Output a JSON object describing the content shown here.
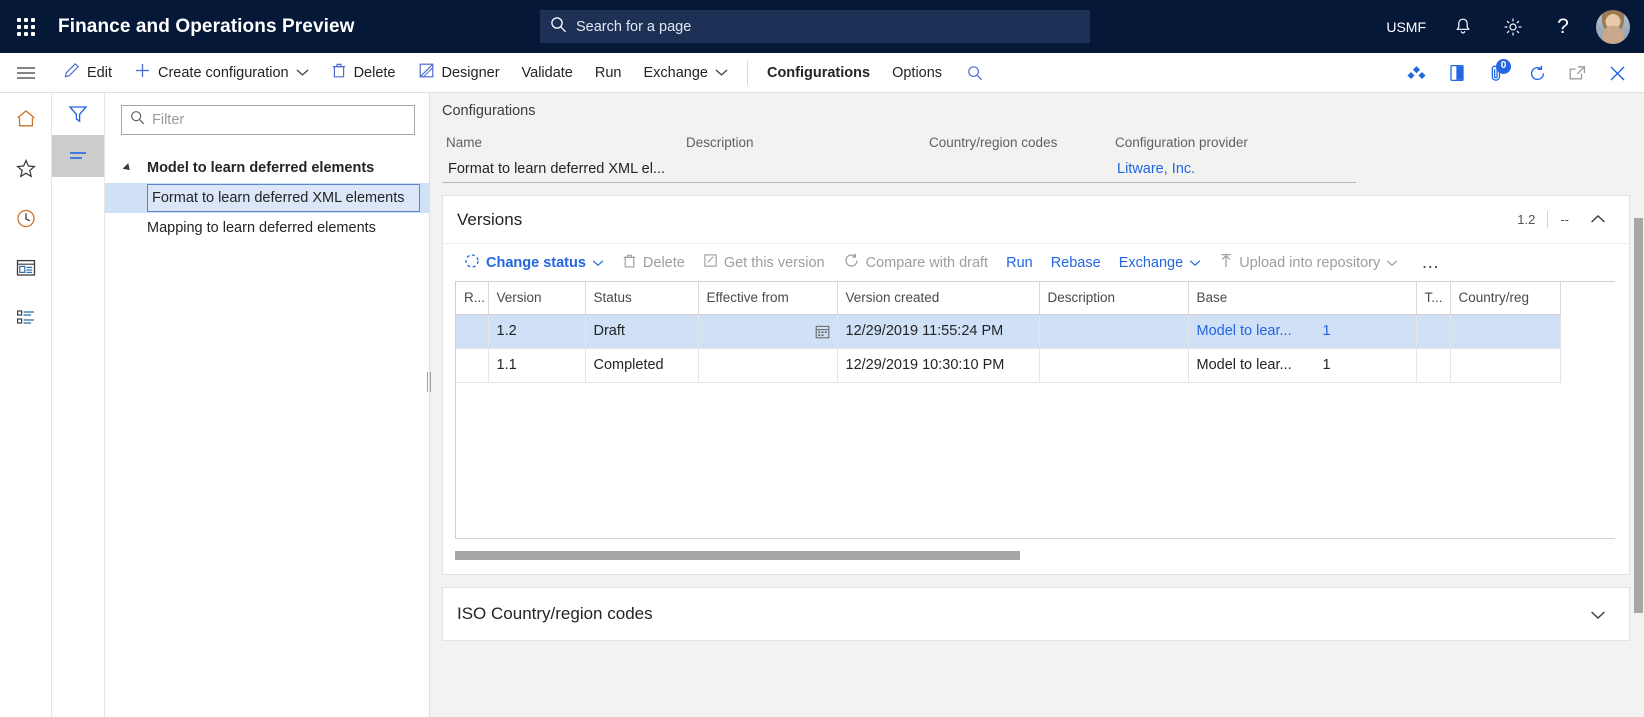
{
  "topbar": {
    "app_title": "Finance and Operations Preview",
    "waffle_icon": "app-launcher-icon",
    "search": {
      "placeholder": "Search for a page",
      "value": "",
      "icon": "search-icon"
    },
    "company": "USMF",
    "notifications_icon": "bell-icon",
    "settings_icon": "gear-icon",
    "help_icon": "question-mark-icon",
    "avatar": "user-avatar",
    "bg_color": "#061838",
    "search_bg_color": "#1d3055"
  },
  "actionpane": {
    "menu_icon": "hamburger-menu-icon",
    "buttons": [
      {
        "label": "Edit",
        "icon": "pencil-icon",
        "has_chevron": false,
        "bold": false
      },
      {
        "label": "Create configuration",
        "icon": "plus-icon",
        "has_chevron": true,
        "bold": false
      },
      {
        "label": "Delete",
        "icon": "trash-icon",
        "has_chevron": false,
        "bold": false
      },
      {
        "label": "Designer",
        "icon": "designer-icon",
        "has_chevron": false,
        "bold": false
      },
      {
        "label": "Validate",
        "icon": "",
        "has_chevron": false,
        "bold": false
      },
      {
        "label": "Run",
        "icon": "",
        "has_chevron": false,
        "bold": false
      },
      {
        "label": "Exchange",
        "icon": "",
        "has_chevron": true,
        "bold": false
      }
    ],
    "tabs": [
      {
        "label": "Configurations",
        "bold": true
      },
      {
        "label": "Options",
        "bold": false
      }
    ],
    "search_icon": "search-icon",
    "right_icons": [
      {
        "name": "relationships-icon",
        "badge": null
      },
      {
        "name": "office-app-icon",
        "badge": null
      },
      {
        "name": "attachments-icon",
        "badge": "0"
      },
      {
        "name": "refresh-icon",
        "badge": null
      },
      {
        "name": "open-in-new-window-icon",
        "badge": null
      },
      {
        "name": "close-icon",
        "badge": null
      }
    ]
  },
  "navrail": {
    "items": [
      {
        "name": "home-icon",
        "label": "Home"
      },
      {
        "name": "star-favorites-icon",
        "label": "Favorites"
      },
      {
        "name": "clock-recent-icon",
        "label": "Recent"
      },
      {
        "name": "workspaces-icon",
        "label": "Workspaces"
      },
      {
        "name": "modules-list-icon",
        "label": "Modules"
      }
    ]
  },
  "filterrail": {
    "items": [
      {
        "name": "filter-funnel-icon",
        "active": false
      },
      {
        "name": "list-lines-icon",
        "active": true
      }
    ]
  },
  "treepane": {
    "filter": {
      "placeholder": "Filter",
      "value": "",
      "icon": "search-icon"
    },
    "nodes": [
      {
        "label": "Model to learn deferred elements",
        "level": 0,
        "expanded": true,
        "selected": false
      },
      {
        "label": "Format to learn deferred XML elements",
        "level": 1,
        "expanded": false,
        "selected": true
      },
      {
        "label": "Mapping to learn deferred elements",
        "level": 1,
        "expanded": false,
        "selected": false
      }
    ]
  },
  "content": {
    "section_header": "Configurations",
    "fields": [
      {
        "label": "Name",
        "value": "Format to learn deferred XML el...",
        "is_link": false
      },
      {
        "label": "Description",
        "value": "",
        "is_link": false
      },
      {
        "label": "Country/region codes",
        "value": "",
        "is_link": false
      },
      {
        "label": "Configuration provider",
        "value": "Litware, Inc.",
        "is_link": true
      }
    ],
    "versions": {
      "title": "Versions",
      "summary_version": "1.2",
      "summary_extra": "--",
      "collapse_icon": "chevron-up-icon",
      "toolbar": [
        {
          "label": "Change status",
          "icon": "status-circle-icon",
          "state": "enabled",
          "chevron": true
        },
        {
          "label": "Delete",
          "icon": "trash-icon",
          "state": "disabled",
          "chevron": false
        },
        {
          "label": "Get this version",
          "icon": "get-version-icon",
          "state": "disabled",
          "chevron": false
        },
        {
          "label": "Compare with draft",
          "icon": "compare-icon",
          "state": "disabled",
          "chevron": false
        },
        {
          "label": "Run",
          "icon": "",
          "state": "plain",
          "chevron": false
        },
        {
          "label": "Rebase",
          "icon": "",
          "state": "plain",
          "chevron": false
        },
        {
          "label": "Exchange",
          "icon": "",
          "state": "plain",
          "chevron": true
        },
        {
          "label": "Upload into repository",
          "icon": "upload-icon",
          "state": "disabled",
          "chevron": true
        }
      ],
      "overflow_label": "…",
      "columns": [
        "R...",
        "Version",
        "Status",
        "Effective from",
        "Version created",
        "Description",
        "Base",
        "T...",
        "Country/reg"
      ],
      "rows": [
        {
          "r": "",
          "version": "1.2",
          "status": "Draft",
          "effective_from": "",
          "effective_from_icon": "calendar-icon",
          "version_created": "12/29/2019 11:55:24 PM",
          "description": "",
          "base_name": "Model to lear...",
          "base_value": "1",
          "base_is_link": true,
          "t": "",
          "country": "",
          "selected": true
        },
        {
          "r": "",
          "version": "1.1",
          "status": "Completed",
          "effective_from": "",
          "effective_from_icon": "",
          "version_created": "12/29/2019 10:30:10 PM",
          "description": "",
          "base_name": "Model to lear...",
          "base_value": "1",
          "base_is_link": false,
          "t": "",
          "country": "",
          "selected": false
        }
      ]
    },
    "iso_section": {
      "title": "ISO Country/region codes",
      "expand_icon": "chevron-down-icon"
    }
  },
  "colors": {
    "accent_blue": "#2266e3",
    "header_navy": "#061838",
    "selection_blue": "#cfe0f7",
    "canvas_gray": "#f2f2f1"
  }
}
